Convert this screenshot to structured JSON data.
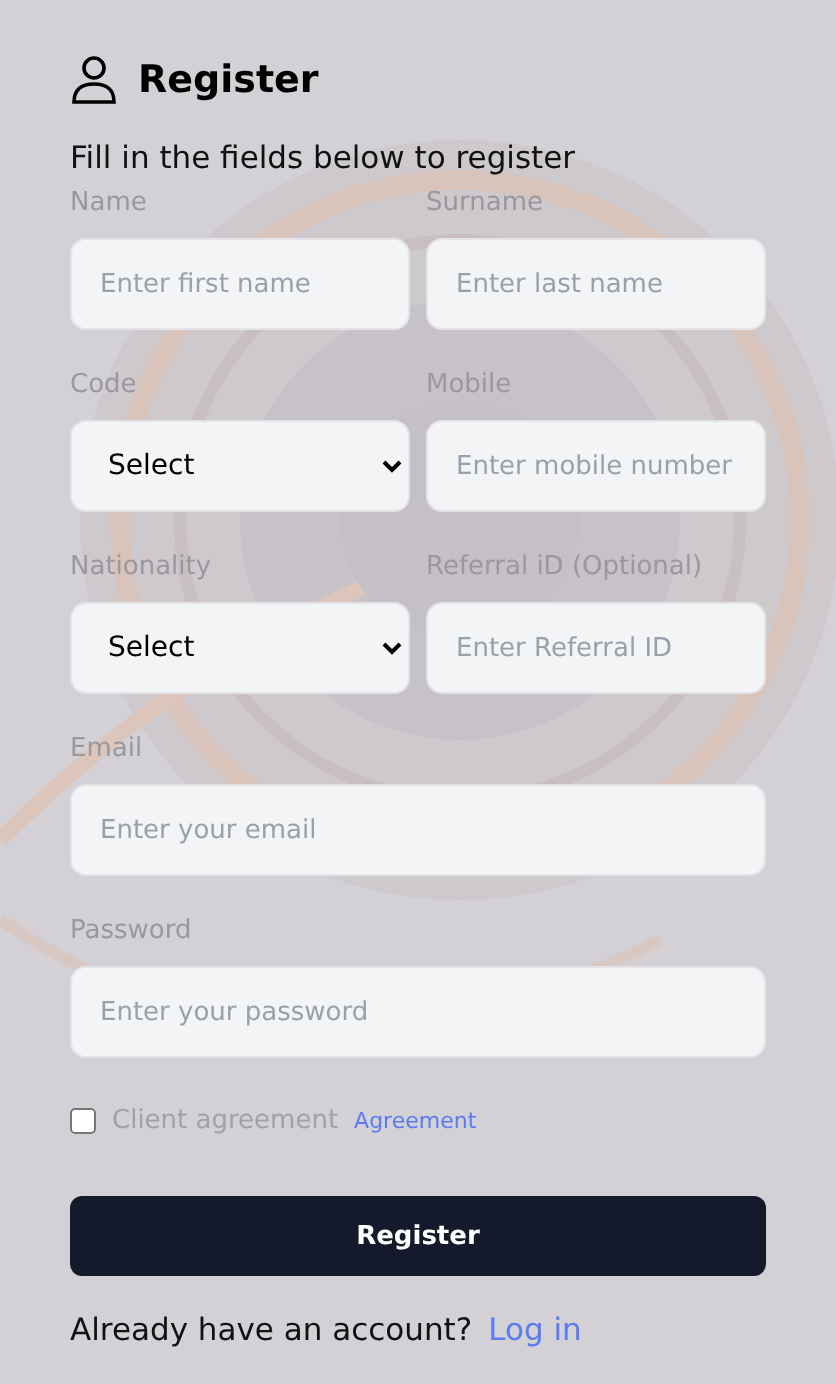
{
  "title": "Register",
  "subtitle": "Fill in the fields below to register",
  "rows": [
    [
      {
        "kind": "input",
        "label": "Name",
        "placeholder": "Enter first name"
      },
      {
        "kind": "input",
        "label": "Surname",
        "placeholder": "Enter last name"
      }
    ],
    [
      {
        "kind": "select",
        "label": "Code",
        "value": "Select"
      },
      {
        "kind": "input",
        "label": "Mobile",
        "placeholder": "Enter mobile number"
      }
    ],
    [
      {
        "kind": "select",
        "label": "Nationality",
        "value": "Select"
      },
      {
        "kind": "input",
        "label": "Referral iD (Optional)",
        "placeholder": "Enter Referral ID"
      }
    ],
    [
      {
        "kind": "input",
        "label": "Email",
        "placeholder": "Enter your email"
      }
    ],
    [
      {
        "kind": "input",
        "label": "Password",
        "placeholder": "Enter your password"
      }
    ]
  ],
  "agreement": {
    "label": "Client agreement",
    "link": "Agreement",
    "checked": false
  },
  "submit": "Register",
  "footer": {
    "text": "Already have an account?",
    "link": "Log in"
  }
}
